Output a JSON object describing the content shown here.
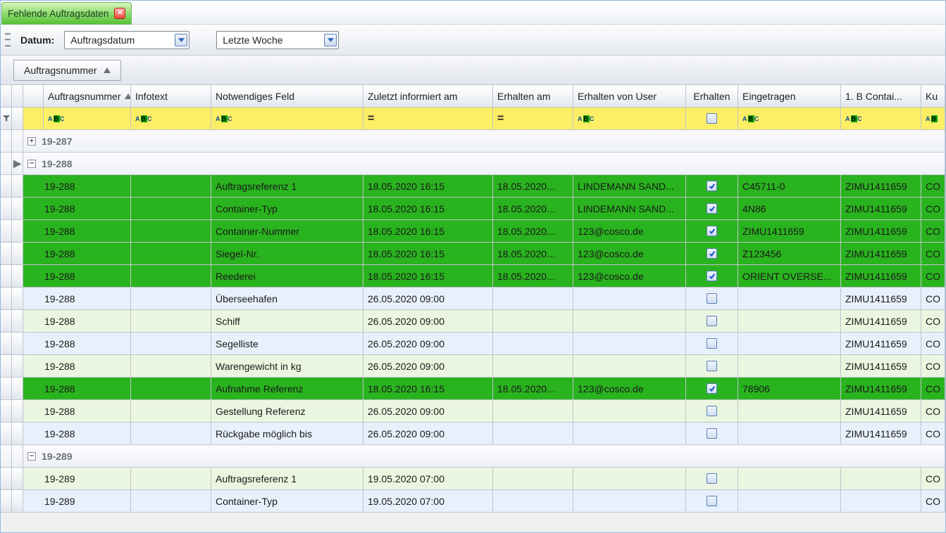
{
  "tab": {
    "title": "Fehlende Auftragsdaten"
  },
  "toolbar": {
    "label": "Datum:",
    "field": "Auftragsdatum",
    "range": "Letzte Woche"
  },
  "group_by": {
    "label": "Auftragsnummer"
  },
  "columns": {
    "auftragsnummer": "Auftragsnummer",
    "infotext": "Infotext",
    "notwendiges_feld": "Notwendiges Feld",
    "zuletzt_informiert": "Zuletzt informiert am",
    "erhalten_am": "Erhalten am",
    "erhalten_von_user": "Erhalten von User",
    "erhalten": "Erhalten",
    "eingetragen": "Eingetragen",
    "container": "1. B Contai...",
    "ku": "Ku"
  },
  "filter_ops": {
    "abc": "abc",
    "eq": "="
  },
  "groups": [
    {
      "id": "19-287",
      "expanded": false,
      "current": false
    },
    {
      "id": "19-288",
      "expanded": true,
      "current": true
    },
    {
      "id": "19-289",
      "expanded": true,
      "current": false
    }
  ],
  "rows_288": [
    {
      "auf": "19-288",
      "feld": "Auftragsreferenz 1",
      "zul": "18.05.2020 16:15",
      "erha": "18.05.2020...",
      "erhu": "LINDEMANN SAND...",
      "erh": true,
      "ein": "C45711-0",
      "b": "ZIMU1411659",
      "ku": "CO",
      "done": true
    },
    {
      "auf": "19-288",
      "feld": "Container-Typ",
      "zul": "18.05.2020 16:15",
      "erha": "18.05.2020...",
      "erhu": "LINDEMANN SAND...",
      "erh": true,
      "ein": "4N86",
      "b": "ZIMU1411659",
      "ku": "CO",
      "done": true
    },
    {
      "auf": "19-288",
      "feld": "Container-Nummer",
      "zul": "18.05.2020 16:15",
      "erha": "18.05.2020...",
      "erhu": "123@cosco.de",
      "erh": true,
      "ein": "ZIMU1411659",
      "b": "ZIMU1411659",
      "ku": "CO",
      "done": true
    },
    {
      "auf": "19-288",
      "feld": "Siegel-Nr.",
      "zul": "18.05.2020 16:15",
      "erha": "18.05.2020...",
      "erhu": "123@cosco.de",
      "erh": true,
      "ein": "Z123456",
      "b": "ZIMU1411659",
      "ku": "CO",
      "done": true
    },
    {
      "auf": "19-288",
      "feld": "Reederei",
      "zul": "18.05.2020 16:15",
      "erha": "18.05.2020...",
      "erhu": "123@cosco.de",
      "erh": true,
      "ein": "ORIENT OVERSE...",
      "b": "ZIMU1411659",
      "ku": "CO",
      "done": true
    },
    {
      "auf": "19-288",
      "feld": "Überseehafen",
      "zul": "26.05.2020 09:00",
      "erha": "",
      "erhu": "",
      "erh": false,
      "ein": "",
      "b": "ZIMU1411659",
      "ku": "CO",
      "done": false
    },
    {
      "auf": "19-288",
      "feld": "Schiff",
      "zul": "26.05.2020 09:00",
      "erha": "",
      "erhu": "",
      "erh": false,
      "ein": "",
      "b": "ZIMU1411659",
      "ku": "CO",
      "done": false
    },
    {
      "auf": "19-288",
      "feld": "Segelliste",
      "zul": "26.05.2020 09:00",
      "erha": "",
      "erhu": "",
      "erh": false,
      "ein": "",
      "b": "ZIMU1411659",
      "ku": "CO",
      "done": false
    },
    {
      "auf": "19-288",
      "feld": "Warengewicht in kg",
      "zul": "26.05.2020 09:00",
      "erha": "",
      "erhu": "",
      "erh": false,
      "ein": "",
      "b": "ZIMU1411659",
      "ku": "CO",
      "done": false
    },
    {
      "auf": "19-288",
      "feld": "Aufnahme Referenz",
      "zul": "18.05.2020 16:15",
      "erha": "18.05.2020...",
      "erhu": "123@cosco.de",
      "erh": true,
      "ein": "78906",
      "b": "ZIMU1411659",
      "ku": "CO",
      "done": true
    },
    {
      "auf": "19-288",
      "feld": "Gestellung Referenz",
      "zul": "26.05.2020 09:00",
      "erha": "",
      "erhu": "",
      "erh": false,
      "ein": "",
      "b": "ZIMU1411659",
      "ku": "CO",
      "done": false
    },
    {
      "auf": "19-288",
      "feld": "Rückgabe möglich bis",
      "zul": "26.05.2020 09:00",
      "erha": "",
      "erhu": "",
      "erh": false,
      "ein": "",
      "b": "ZIMU1411659",
      "ku": "CO",
      "done": false
    }
  ],
  "rows_289": [
    {
      "auf": "19-289",
      "feld": "Auftragsreferenz 1",
      "zul": "19.05.2020 07:00",
      "erha": "",
      "erhu": "",
      "erh": false,
      "ein": "",
      "b": "",
      "ku": "CO",
      "done": false
    },
    {
      "auf": "19-289",
      "feld": "Container-Typ",
      "zul": "19.05.2020 07:00",
      "erha": "",
      "erhu": "",
      "erh": false,
      "ein": "",
      "b": "",
      "ku": "CO",
      "done": false
    }
  ]
}
